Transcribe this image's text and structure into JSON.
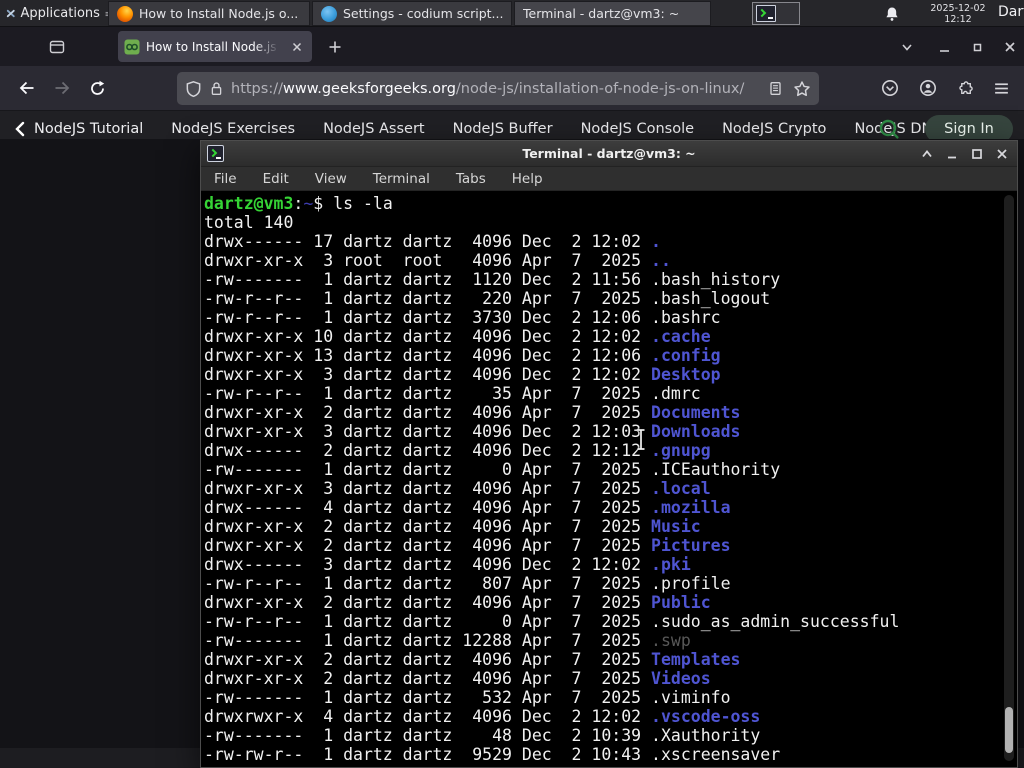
{
  "colors": {
    "panel_bg": "#26262a",
    "firefox_tab_active": "#42414d",
    "toolbar_bg": "#2b2a33",
    "gfg_green": "#2f8d46",
    "terminal_bg": "#000000",
    "terminal_fg": "#f1f1f1",
    "terminal_dir_blue": "#4f55d2",
    "terminal_prompt_green": "#35d435",
    "terminal_dim_gray": "#585858"
  },
  "icons": [
    "xfce-logo-icon",
    "menu-lines-icon",
    "firefox-icon",
    "vscodium-icon",
    "terminal-icon",
    "workspace-pager-icon",
    "bell-icon",
    "firefox-view-icon",
    "gfg-favicon",
    "close-icon",
    "plus-icon",
    "chevron-down-icon",
    "minimize-icon",
    "maximize-icon",
    "back-arrow-icon",
    "forward-arrow-icon",
    "reload-icon",
    "shield-icon",
    "lock-icon",
    "reader-mode-icon",
    "star-icon",
    "pocket-icon",
    "account-icon",
    "extensions-puzzle-icon",
    "hamburger-menu-icon",
    "chevron-left-icon",
    "chevron-right-icon",
    "search-icon",
    "shade-icon",
    "ibeam-cursor"
  ],
  "panel": {
    "applications": "Applications",
    "windows": [
      {
        "title": "How to Install Node.js o...",
        "app": "firefox"
      },
      {
        "title": "Settings - codium script...",
        "app": "vscodium"
      },
      {
        "title": "Terminal - dartz@vm3: ~",
        "app": "terminal"
      }
    ],
    "date": "2025-12-02",
    "time": "12:12",
    "user": "Dartz"
  },
  "browser": {
    "tab_title": "How to Install Node.js on",
    "url_scheme": "https://",
    "url_domain": "www.geeksforgeeks.org",
    "url_path": "/node-js/installation-of-node-js-on-linux/"
  },
  "site_nav": {
    "items": [
      {
        "label": "NodeJS Tutorial"
      },
      {
        "label": "NodeJS Exercises"
      },
      {
        "label": "NodeJS Assert"
      },
      {
        "label": "NodeJS Buffer"
      },
      {
        "label": "NodeJS Console"
      },
      {
        "label": "NodeJS Crypto"
      },
      {
        "label": "NodeJS DNS"
      },
      {
        "label": "Node",
        "cls": "truncated"
      }
    ],
    "sign_in": "Sign In"
  },
  "terminal": {
    "window_title": "Terminal - dartz@vm3: ~",
    "menus": [
      {
        "label": "File"
      },
      {
        "label": "Edit"
      },
      {
        "label": "View"
      },
      {
        "label": "Terminal"
      },
      {
        "label": "Tabs"
      },
      {
        "label": "Help"
      }
    ],
    "prompt_user": "dartz@vm3",
    "prompt_sep": ":",
    "prompt_path": "~",
    "prompt_symbol": "$ ",
    "command": "ls -la",
    "total": "total 140",
    "listing": [
      {
        "pre": "drwx------ 17 dartz dartz  4096 Dec  2 12:02 ",
        "name": ".",
        "cls": "t-name-dir"
      },
      {
        "pre": "drwxr-xr-x  3 root  root   4096 Apr  7  2025 ",
        "name": "..",
        "cls": "t-name-dir"
      },
      {
        "pre": "-rw-------  1 dartz dartz  1120 Dec  2 11:56 ",
        "name": ".bash_history",
        "cls": "t-name-file"
      },
      {
        "pre": "-rw-r--r--  1 dartz dartz   220 Apr  7  2025 ",
        "name": ".bash_logout",
        "cls": "t-name-file"
      },
      {
        "pre": "-rw-r--r--  1 dartz dartz  3730 Dec  2 12:06 ",
        "name": ".bashrc",
        "cls": "t-name-file"
      },
      {
        "pre": "drwxr-xr-x 10 dartz dartz  4096 Dec  2 12:02 ",
        "name": ".cache",
        "cls": "t-name-dir"
      },
      {
        "pre": "drwxr-xr-x 13 dartz dartz  4096 Dec  2 12:06 ",
        "name": ".config",
        "cls": "t-name-dir"
      },
      {
        "pre": "drwxr-xr-x  3 dartz dartz  4096 Dec  2 12:02 ",
        "name": "Desktop",
        "cls": "t-name-dir"
      },
      {
        "pre": "-rw-r--r--  1 dartz dartz    35 Apr  7  2025 ",
        "name": ".dmrc",
        "cls": "t-name-file"
      },
      {
        "pre": "drwxr-xr-x  2 dartz dartz  4096 Apr  7  2025 ",
        "name": "Documents",
        "cls": "t-name-dir"
      },
      {
        "pre": "drwxr-xr-x  3 dartz dartz  4096 Dec  2 12:03 ",
        "name": "Downloads",
        "cls": "t-name-dir"
      },
      {
        "pre": "drwx------  2 dartz dartz  4096 Dec  2 12:12 ",
        "name": ".gnupg",
        "cls": "t-name-dir"
      },
      {
        "pre": "-rw-------  1 dartz dartz     0 Apr  7  2025 ",
        "name": ".ICEauthority",
        "cls": "t-name-file"
      },
      {
        "pre": "drwxr-xr-x  3 dartz dartz  4096 Apr  7  2025 ",
        "name": ".local",
        "cls": "t-name-dir"
      },
      {
        "pre": "drwx------  4 dartz dartz  4096 Apr  7  2025 ",
        "name": ".mozilla",
        "cls": "t-name-dir"
      },
      {
        "pre": "drwxr-xr-x  2 dartz dartz  4096 Apr  7  2025 ",
        "name": "Music",
        "cls": "t-name-dir"
      },
      {
        "pre": "drwxr-xr-x  2 dartz dartz  4096 Apr  7  2025 ",
        "name": "Pictures",
        "cls": "t-name-dir"
      },
      {
        "pre": "drwx------  3 dartz dartz  4096 Dec  2 12:02 ",
        "name": ".pki",
        "cls": "t-name-dir"
      },
      {
        "pre": "-rw-r--r--  1 dartz dartz   807 Apr  7  2025 ",
        "name": ".profile",
        "cls": "t-name-file"
      },
      {
        "pre": "drwxr-xr-x  2 dartz dartz  4096 Apr  7  2025 ",
        "name": "Public",
        "cls": "t-name-dir"
      },
      {
        "pre": "-rw-r--r--  1 dartz dartz     0 Apr  7  2025 ",
        "name": ".sudo_as_admin_successful",
        "cls": "t-name-file"
      },
      {
        "pre": "-rw-------  1 dartz dartz 12288 Apr  7  2025 ",
        "name": ".swp",
        "cls": "t-name-dim"
      },
      {
        "pre": "drwxr-xr-x  2 dartz dartz  4096 Apr  7  2025 ",
        "name": "Templates",
        "cls": "t-name-dir"
      },
      {
        "pre": "drwxr-xr-x  2 dartz dartz  4096 Apr  7  2025 ",
        "name": "Videos",
        "cls": "t-name-dir"
      },
      {
        "pre": "-rw-------  1 dartz dartz   532 Apr  7  2025 ",
        "name": ".viminfo",
        "cls": "t-name-file"
      },
      {
        "pre": "drwxrwxr-x  4 dartz dartz  4096 Dec  2 12:02 ",
        "name": ".vscode-oss",
        "cls": "t-name-dir"
      },
      {
        "pre": "-rw-------  1 dartz dartz    48 Dec  2 10:39 ",
        "name": ".Xauthority",
        "cls": "t-name-file"
      },
      {
        "pre": "-rw-rw-r--  1 dartz dartz  9529 Dec  2 10:43 ",
        "name": ".xscreensaver",
        "cls": "t-name-file"
      }
    ]
  }
}
